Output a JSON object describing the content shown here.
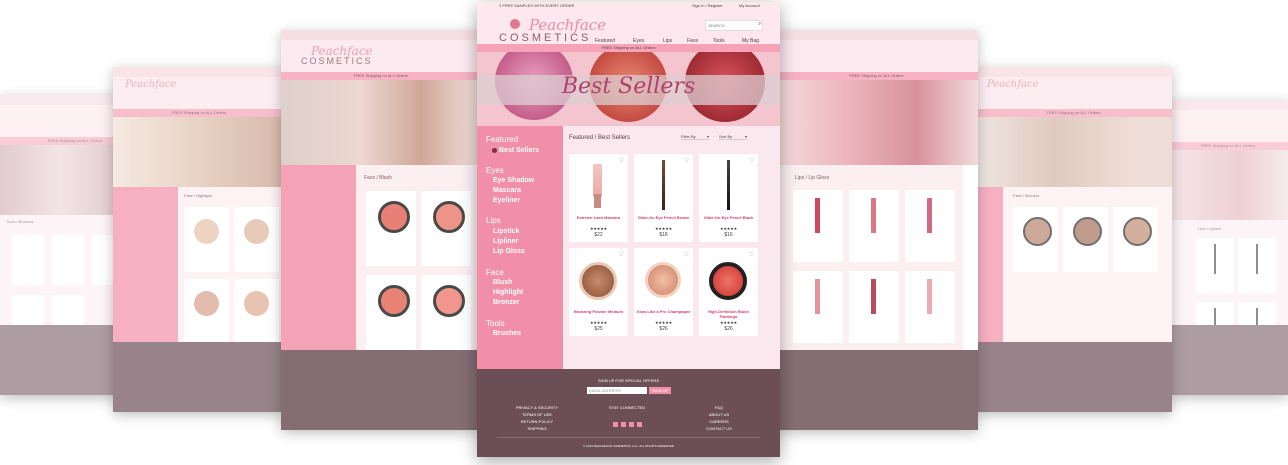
{
  "site": {
    "logo_script": "Peachface",
    "logo_word": "COSMETICS",
    "promo": "2 FREE SAMPLES WITH EVERY ORDER",
    "sign_in": "Sign In / Register",
    "my_account": "My Account",
    "search_placeholder": "SEARCH",
    "shipping_banner": "FREE Shipping on ALL Orders",
    "nav": [
      "Featured",
      "Eyes",
      "Lips",
      "Face",
      "Tools",
      "My Bag"
    ]
  },
  "hero": {
    "title": "Best Sellers"
  },
  "sidebar": {
    "groups": [
      {
        "heading": "Featured",
        "items": [
          "Best Sellers"
        ]
      },
      {
        "heading": "Eyes",
        "items": [
          "Eye Shadow",
          "Mascara",
          "Eyeliner"
        ]
      },
      {
        "heading": "Lips",
        "items": [
          "Lipstick",
          "Lipliner",
          "Lip Gloss"
        ]
      },
      {
        "heading": "Face",
        "items": [
          "Blush",
          "Highlight",
          "Bronzer"
        ]
      },
      {
        "heading": "Tools",
        "items": [
          "Brushes"
        ]
      }
    ]
  },
  "main": {
    "breadcrumb": "Featured / Best Sellers",
    "filter_label": "Filter By",
    "sort_label": "Sort By",
    "products": [
      {
        "name": "Extreme Lash Mascara",
        "price": "$22",
        "stars": "★★★★★"
      },
      {
        "name": "Glide-On Eye Pencil Brown",
        "price": "$18",
        "stars": "★★★★★"
      },
      {
        "name": "Glide-On Eye Pencil Black",
        "price": "$16",
        "stars": "★★★★★"
      },
      {
        "name": "Bronzing Powder Medium",
        "price": "$25",
        "stars": "★★★★★"
      },
      {
        "name": "Glow Like a Pro Champagne",
        "price": "$26",
        "stars": "★★★★★"
      },
      {
        "name": "High-Definition Blush Flamingo",
        "price": "$26",
        "stars": "★★★★★"
      }
    ]
  },
  "footer": {
    "signup_heading": "SIGN UP FOR SPECIAL OFFERS",
    "email_placeholder": "EMAIL ADDRESS",
    "signup_button": "SIGN UP",
    "links_left": [
      "PRIVACY & SECURITY",
      "TERMS OF USE",
      "RETURN POLICY",
      "SHIPPING"
    ],
    "stay_connected": "STAY CONNECTED",
    "links_right": [
      "FAQ",
      "ABOUT US",
      "CAREERS",
      "CONTACT US"
    ],
    "copyright": "© 2014 PEACHFACE COSMETICS, LLC. ALL RIGHTS RESERVED"
  },
  "side_pages": {
    "blush_crumb": "Face / Blush",
    "highlight_crumb": "Face / Highlight",
    "brushes_crumb": "Tools / Brushes",
    "lipgloss_crumb": "Lips / Lip Gloss",
    "bronzer_crumb": "Face / Bronzer",
    "lipliner_crumb": "Lips / Lipliner"
  },
  "colors": {
    "accent": "#f28fa8",
    "brand": "#d33b68",
    "footer": "#6b4e56",
    "banner": "#f6a3b7"
  }
}
